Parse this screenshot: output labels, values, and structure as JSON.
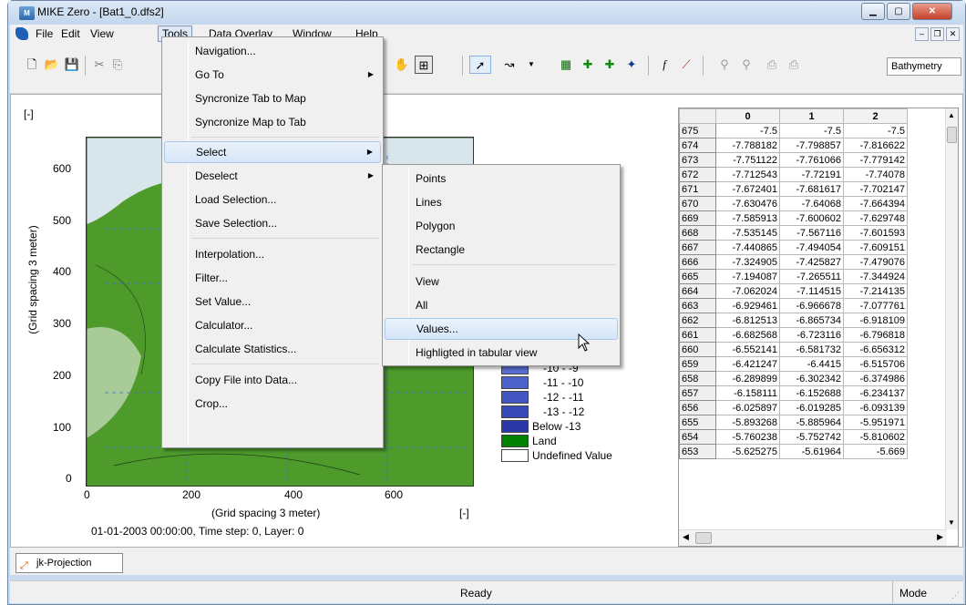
{
  "window": {
    "title": "MIKE Zero - [Bat1_0.dfs2]",
    "icon": "mike-zero-icon"
  },
  "menubar": [
    "File",
    "Edit",
    "View",
    "Tools",
    "Data Overlay",
    "Window",
    "Help"
  ],
  "toolbar": {
    "dropdown_value": "Bathymetry"
  },
  "map": {
    "corner_unit": "[-]",
    "y_label": "(Grid spacing 3 meter)",
    "x_label": "(Grid spacing 3 meter)",
    "x_unit": "[-]",
    "y_ticks": [
      "600",
      "500",
      "400",
      "300",
      "200",
      "100",
      "0"
    ],
    "x_ticks": [
      "0",
      "200",
      "400",
      "600"
    ],
    "footer": "01-01-2003 00:00:00, Time step: 0, Layer: 0"
  },
  "legend": [
    {
      "label": "-10 - -9",
      "color": "#5a6fd3"
    },
    {
      "label": "-11 - -10",
      "color": "#4e62cc"
    },
    {
      "label": "-12 - -11",
      "color": "#4356c2"
    },
    {
      "label": "-13 - -12",
      "color": "#3849b8"
    },
    {
      "label": "Below -13",
      "color": "#2b39a8"
    },
    {
      "label": "Land",
      "color": "#008000"
    },
    {
      "label": "Undefined Value",
      "color": "#ffffff"
    }
  ],
  "tools_menu": {
    "items": [
      "Navigation...",
      "Go To",
      "Syncronize Tab to Map",
      "Syncronize Map to Tab",
      "Select",
      "Deselect",
      "Load Selection...",
      "Save Selection...",
      "Interpolation...",
      "Filter...",
      "Set Value...",
      "Calculator...",
      "Calculate Statistics...",
      "Copy File into Data...",
      "Crop..."
    ]
  },
  "select_menu": {
    "items": [
      "Points",
      "Lines",
      "Polygon",
      "Rectangle",
      "View",
      "All",
      "Values...",
      "Highligted in tabular view"
    ]
  },
  "grid": {
    "columns": [
      "0",
      "1",
      "2"
    ],
    "rows": [
      [
        "675",
        "-7.5",
        "-7.5",
        "-7.5"
      ],
      [
        "674",
        "-7.788182",
        "-7.798857",
        "-7.816622"
      ],
      [
        "673",
        "-7.751122",
        "-7.761066",
        "-7.779142"
      ],
      [
        "672",
        "-7.712543",
        "-7.72191",
        "-7.74078"
      ],
      [
        "671",
        "-7.672401",
        "-7.681617",
        "-7.702147"
      ],
      [
        "670",
        "-7.630476",
        "-7.64068",
        "-7.664394"
      ],
      [
        "669",
        "-7.585913",
        "-7.600602",
        "-7.629748"
      ],
      [
        "668",
        "-7.535145",
        "-7.567116",
        "-7.601593"
      ],
      [
        "667",
        "-7.440865",
        "-7.494054",
        "-7.609151"
      ],
      [
        "666",
        "-7.324905",
        "-7.425827",
        "-7.479076"
      ],
      [
        "665",
        "-7.194087",
        "-7.265511",
        "-7.344924"
      ],
      [
        "664",
        "-7.062024",
        "-7.114515",
        "-7.214135"
      ],
      [
        "663",
        "-6.929461",
        "-6.966678",
        "-7.077761"
      ],
      [
        "662",
        "-6.812513",
        "-6.865734",
        "-6.918109"
      ],
      [
        "661",
        "-6.682568",
        "-6.723116",
        "-6.796818"
      ],
      [
        "660",
        "-6.552141",
        "-6.581732",
        "-6.656312"
      ],
      [
        "659",
        "-6.421247",
        "-6.4415",
        "-6.515706"
      ],
      [
        "658",
        "-6.289899",
        "-6.302342",
        "-6.374986"
      ],
      [
        "657",
        "-6.158111",
        "-6.152688",
        "-6.234137"
      ],
      [
        "656",
        "-6.025897",
        "-6.019285",
        "-6.093139"
      ],
      [
        "655",
        "-5.893268",
        "-5.885964",
        "-5.951971"
      ],
      [
        "654",
        "-5.760238",
        "-5.752742",
        "-5.810602"
      ],
      [
        "653",
        "-5.625275",
        "-5.61964",
        "-5.669"
      ]
    ]
  },
  "tab": {
    "label": "jk-Projection"
  },
  "status": {
    "text": "Ready",
    "mode": "Mode"
  }
}
